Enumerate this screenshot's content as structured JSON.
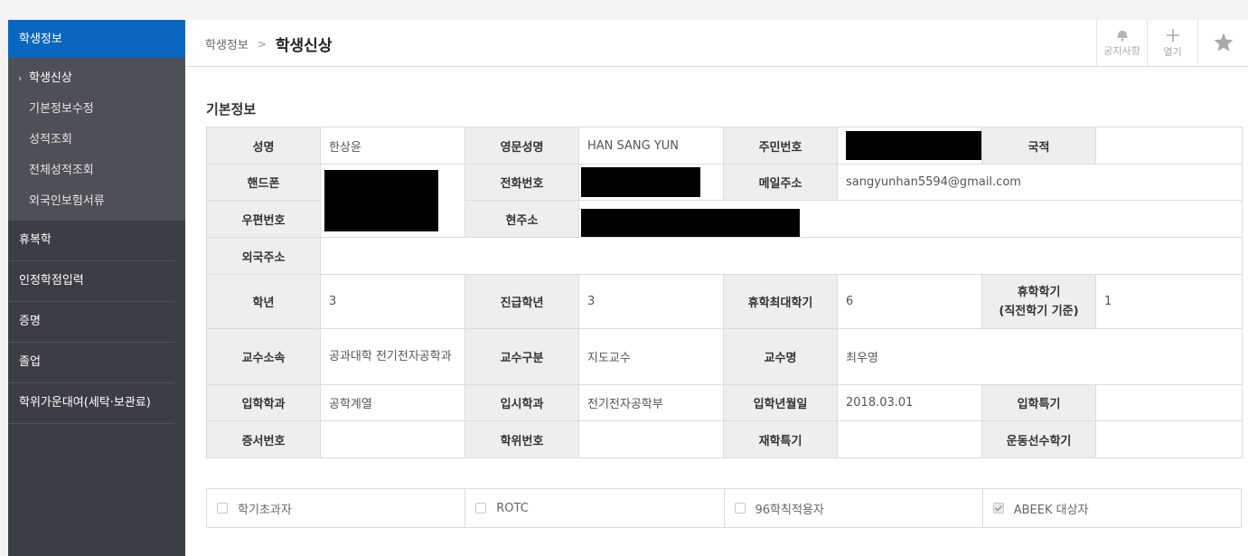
{
  "sidebar": {
    "header": "학생정보",
    "sub_items": [
      {
        "label": "학생신상",
        "active": true
      },
      {
        "label": "기본정보수정"
      },
      {
        "label": "성적조회"
      },
      {
        "label": "전체성적조회"
      },
      {
        "label": "외국인보험서류"
      }
    ],
    "menu": [
      {
        "label": "휴복학"
      },
      {
        "label": "인정학점입력"
      },
      {
        "label": "증명"
      },
      {
        "label": "졸업"
      },
      {
        "label": "학위가운대여(세탁·보관료)"
      }
    ]
  },
  "breadcrumb": {
    "parent": "학생정보",
    "separator": ">",
    "current": "학생신상"
  },
  "actions": {
    "notice": "공지사항",
    "open": "열기"
  },
  "section_title": "기본정보",
  "info": {
    "name_label": "성명",
    "name": "한상윤",
    "eng_name_label": "영문성명",
    "eng_name": "HAN SANG YUN",
    "rrn_label": "주민번호",
    "nationality_label": "국적",
    "mobile_label": "핸드폰",
    "phone_label": "전화번호",
    "email_label": "메일주소",
    "email": "sangyunhan5594@gmail.com",
    "postal_label": "우편번호",
    "address_label": "현주소",
    "foreign_address_label": "외국주소",
    "grade_label": "학년",
    "grade": "3",
    "promo_grade_label": "진급학년",
    "promo_grade": "3",
    "max_leave_label": "휴학최대학기",
    "max_leave": "6",
    "leave_sem_label_1": "휴학학기",
    "leave_sem_label_2": "(직전학기 기준)",
    "leave_sem": "1",
    "prof_dept_label": "교수소속",
    "prof_dept": "공과대학 전기전자공학과",
    "prof_type_label": "교수구분",
    "prof_type": "지도교수",
    "prof_name_label": "교수명",
    "prof_name": "최우영",
    "adm_dept_label": "입학학과",
    "adm_dept": "공학계열",
    "exam_dept_label": "입시학과",
    "exam_dept": "전기전자공학부",
    "adm_date_label": "입학년월일",
    "adm_date": "2018.03.01",
    "adm_special_label": "입학특기",
    "cert_no_label": "증서번호",
    "degree_no_label": "학위번호",
    "enroll_special_label": "재학특기",
    "athlete_sem_label": "운동선수학기"
  },
  "checks": [
    {
      "label": "학기초과자",
      "checked": false
    },
    {
      "label": "ROTC",
      "checked": false
    },
    {
      "label": "96학칙적용자",
      "checked": false
    },
    {
      "label": "ABEEK 대상자",
      "checked": true
    }
  ]
}
